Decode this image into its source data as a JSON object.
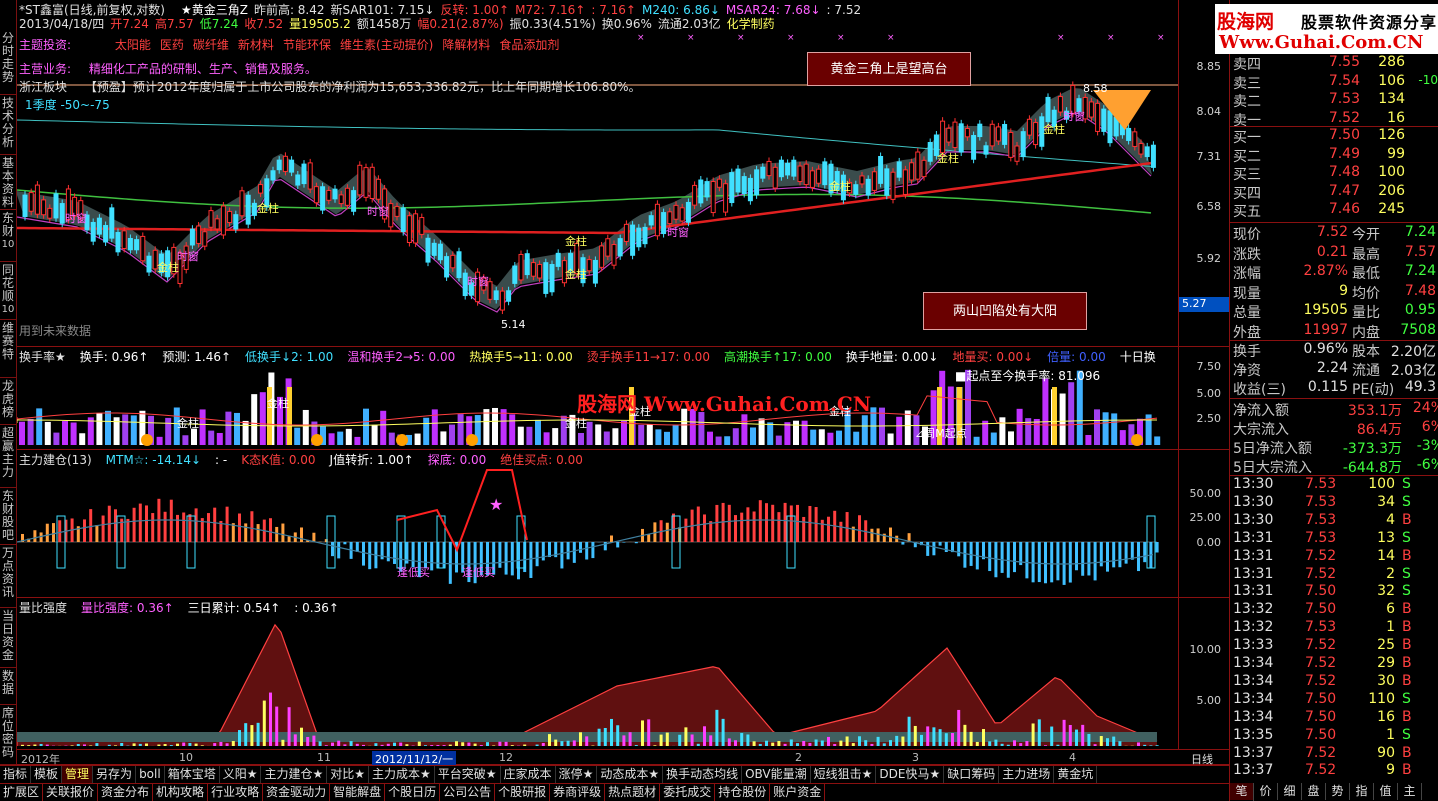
{
  "header": {
    "row1": [
      {
        "text": "*ST鑫富(日线,前复权,对数)",
        "color": "#e0e0e0"
      },
      {
        "text": "★黄金三角Z",
        "color": "#ffffff"
      },
      {
        "text": "昨前高: 8.42",
        "color": "#e0e0e0"
      },
      {
        "text": "新SAR101: 7.15↓",
        "color": "#e0e0e0"
      },
      {
        "text": "反转: 1.00↑",
        "color": "#ff4040"
      },
      {
        "text": "M72: 7.16↑",
        "color": "#ff4040"
      },
      {
        "text": ": 7.16↑",
        "color": "#ff4040"
      },
      {
        "text": "M240: 6.86↓",
        "color": "#40e0ff"
      },
      {
        "text": "MSAR24: 7.68↓",
        "color": "#ff60ff"
      },
      {
        "text": ": 7.52",
        "color": "#e0e0e0"
      }
    ],
    "row2": [
      {
        "text": "2013/04/18/四",
        "color": "#e0e0e0"
      },
      {
        "text": "开7.24",
        "color": "#ff4040"
      },
      {
        "text": "高7.57",
        "color": "#ff4040"
      },
      {
        "text": "低7.24",
        "color": "#40ff40"
      },
      {
        "text": "收7.52",
        "color": "#ff4040"
      },
      {
        "text": "量19505.2",
        "color": "#ffff60"
      },
      {
        "text": "额1458万",
        "color": "#e0e0e0"
      },
      {
        "text": "幅0.21(2.87%)",
        "color": "#ff4040"
      },
      {
        "text": "振0.33(4.51%)",
        "color": "#e0e0e0"
      },
      {
        "text": "换0.96%",
        "color": "#e0e0e0"
      },
      {
        "text": "流通2.03亿",
        "color": "#e0e0e0"
      },
      {
        "text": "化学制药",
        "color": "#ffff60"
      }
    ],
    "theme_label": "主题投资:",
    "themes": [
      "太阳能",
      "医药",
      "碳纤维",
      "新材料",
      "节能环保",
      "维生素(主动提价)",
      "降解材料",
      "食品添加剂"
    ],
    "business_label": "主营业务:",
    "business": "精细化工产品的研制、生产、销售及服务。",
    "region": "浙江板块",
    "news": "【预盈】预计2012年度归属于上市公司股东的净利润为15,653,336.82元，比上年同期增长106.80%。",
    "quarter": "1季度 -50~-75",
    "future_label": "用到未来数据"
  },
  "price_pane": {
    "y_ticks": [
      "8.85",
      "8.04",
      "7.31",
      "6.58",
      "5.92"
    ],
    "current_price_tag": "5.27",
    "low_label": "5.14",
    "high_label": "8.58",
    "note_top": "黄金三角上是望高台",
    "note_bottom": "两山凹陷处有大阳",
    "jinzhu": "金柱",
    "shichuang": "时窗"
  },
  "turnover_pane": {
    "header": [
      {
        "text": "换手率★",
        "color": "#e0e0e0"
      },
      {
        "text": "换手: 0.96↑",
        "color": "#ffffff"
      },
      {
        "text": "预测: 1.46↑",
        "color": "#ffffff"
      },
      {
        "text": "低换手↓2: 1.00",
        "color": "#40e0ff"
      },
      {
        "text": "温和换手2→5: 0.00",
        "color": "#ff60ff"
      },
      {
        "text": "热换手5→11: 0.00",
        "color": "#ffff60"
      },
      {
        "text": "烫手换手11→17: 0.00",
        "color": "#ff4040"
      },
      {
        "text": "高潮换手↑17: 0.00",
        "color": "#40ff40"
      },
      {
        "text": "换手地量: 0.00↓",
        "color": "#ffffff"
      },
      {
        "text": "地量买: 0.00↓",
        "color": "#ff4040"
      },
      {
        "text": "倍量: 0.00",
        "color": "#4060ff"
      },
      {
        "text": "十日换",
        "color": "#ffffff"
      }
    ],
    "y_ticks": [
      "7.50",
      "5.00",
      "2.50"
    ],
    "start_label": "■起点至今换手率: 81.096",
    "week_label": "周M起点"
  },
  "main_force_pane": {
    "header": [
      {
        "text": "主力建仓(13)",
        "color": "#e0e0e0"
      },
      {
        "text": "MTM☆: -14.14↓",
        "color": "#40e0ff"
      },
      {
        "text": ": -",
        "color": "#ffffff"
      },
      {
        "text": "K态K值: 0.00",
        "color": "#ff4040"
      },
      {
        "text": "J值转折: 1.00↑",
        "color": "#ffffff"
      },
      {
        "text": "探底: 0.00",
        "color": "#ff60ff"
      },
      {
        "text": "绝佳买点: 0.00",
        "color": "#ff4040"
      }
    ],
    "y_ticks": [
      "50.00",
      "25.00",
      "0.00"
    ],
    "label_a": "逢低买",
    "label_b": "逢低买"
  },
  "vol_ratio_pane": {
    "header": [
      {
        "text": "量比强度",
        "color": "#e0e0e0"
      },
      {
        "text": "量比强度: 0.36↑",
        "color": "#ff60ff"
      },
      {
        "text": "三日累计: 0.54↑",
        "color": "#ffffff"
      },
      {
        "text": ": 0.36↑",
        "color": "#ffffff"
      }
    ],
    "y_ticks": [
      "10.00",
      "5.00"
    ]
  },
  "date_axis": {
    "labels": [
      "2012年",
      "10",
      "11",
      "2012/11/12/一",
      "12",
      "2",
      "3",
      "4"
    ],
    "period": "日线"
  },
  "watermark": "股海网 Www.Guhai.Com.CN",
  "logo": {
    "line1": "股海网",
    "line1b": "股票软件资源分享",
    "line2": "Www.Guhai.Com.CN"
  },
  "left_tabs": [
    {
      "label": "分时走势",
      "num": ""
    },
    {
      "label": "技术分析",
      "num": ""
    },
    {
      "label": "基本资料",
      "num": ""
    },
    {
      "label": "东财",
      "num": "10"
    },
    {
      "label": "同花顺",
      "num": "10"
    },
    {
      "label": "维赛特",
      "num": ""
    },
    {
      "label": "龙虎榜",
      "num": ""
    },
    {
      "label": "超赢主力",
      "num": ""
    },
    {
      "label": "东财股吧",
      "num": ""
    },
    {
      "label": "万点资讯",
      "num": ""
    },
    {
      "label": "当日资金",
      "num": ""
    },
    {
      "label": "数据",
      "num": ""
    },
    {
      "label": "席位密码",
      "num": ""
    },
    {
      "label": "公",
      "num": ""
    }
  ],
  "order_book": {
    "asks": [
      {
        "label": "卖四",
        "price": "7.55",
        "vol": "286",
        "chg": ""
      },
      {
        "label": "卖三",
        "price": "7.54",
        "vol": "106",
        "chg": "-10"
      },
      {
        "label": "卖二",
        "price": "7.53",
        "vol": "134",
        "chg": ""
      },
      {
        "label": "卖一",
        "price": "7.52",
        "vol": "16",
        "chg": ""
      }
    ],
    "bids": [
      {
        "label": "买一",
        "price": "7.50",
        "vol": "126",
        "chg": ""
      },
      {
        "label": "买二",
        "price": "7.49",
        "vol": "99",
        "chg": ""
      },
      {
        "label": "买三",
        "price": "7.48",
        "vol": "100",
        "chg": ""
      },
      {
        "label": "买四",
        "price": "7.47",
        "vol": "206",
        "chg": ""
      },
      {
        "label": "买五",
        "price": "7.46",
        "vol": "245",
        "chg": ""
      }
    ]
  },
  "quote": [
    {
      "l": "现价",
      "lv": "7.52",
      "lc": "red",
      "r": "今开",
      "rv": "7.24",
      "rc": "green"
    },
    {
      "l": "涨跌",
      "lv": "0.21",
      "lc": "red",
      "r": "最高",
      "rv": "7.57",
      "rc": "red"
    },
    {
      "l": "涨幅",
      "lv": "2.87%",
      "lc": "red",
      "r": "最低",
      "rv": "7.24",
      "rc": "green"
    },
    {
      "l": "现量",
      "lv": "9",
      "lc": "yellow",
      "r": "均价",
      "rv": "7.48",
      "rc": "red"
    },
    {
      "l": "总量",
      "lv": "19505",
      "lc": "yellow",
      "r": "量比",
      "rv": "0.95",
      "rc": "green"
    },
    {
      "l": "外盘",
      "lv": "11997",
      "lc": "red",
      "r": "内盘",
      "rv": "7508",
      "rc": "green"
    }
  ],
  "quote2": [
    {
      "l": "换手",
      "lv": "0.96%",
      "lc": "white",
      "r": "股本",
      "rv": "2.20亿",
      "rc": "white"
    },
    {
      "l": "净资",
      "lv": "2.24",
      "lc": "white",
      "r": "流通",
      "rv": "2.03亿",
      "rc": "white"
    },
    {
      "l": "收益(三)",
      "lv": "0.115",
      "lc": "white",
      "r": "PE(动)",
      "rv": "49.3",
      "rc": "white"
    }
  ],
  "flows": [
    {
      "l": "净流入额",
      "v": "353.1万",
      "p": "24%",
      "c": "red"
    },
    {
      "l": "大宗流入",
      "v": "86.4万",
      "p": "6%",
      "c": "red"
    },
    {
      "l": "5日净流入额",
      "v": "-373.3万",
      "p": "-3%",
      "c": "green"
    },
    {
      "l": "5日大宗流入",
      "v": "-644.8万",
      "p": "-6%",
      "c": "green"
    }
  ],
  "ticks": [
    {
      "t": "13:30",
      "p": "7.53",
      "v": "100",
      "d": "S",
      "dc": "green"
    },
    {
      "t": "13:30",
      "p": "7.53",
      "v": "34",
      "d": "S",
      "dc": "green"
    },
    {
      "t": "13:30",
      "p": "7.53",
      "v": "4",
      "d": "B",
      "dc": "red"
    },
    {
      "t": "13:31",
      "p": "7.53",
      "v": "13",
      "d": "S",
      "dc": "green"
    },
    {
      "t": "13:31",
      "p": "7.52",
      "v": "14",
      "d": "B",
      "dc": "red"
    },
    {
      "t": "13:31",
      "p": "7.52",
      "v": "2",
      "d": "S",
      "dc": "green"
    },
    {
      "t": "13:31",
      "p": "7.50",
      "v": "32",
      "d": "S",
      "dc": "green"
    },
    {
      "t": "13:32",
      "p": "7.50",
      "v": "6",
      "d": "B",
      "dc": "red"
    },
    {
      "t": "13:32",
      "p": "7.53",
      "v": "1",
      "d": "B",
      "dc": "red"
    },
    {
      "t": "13:33",
      "p": "7.52",
      "v": "25",
      "d": "B",
      "dc": "red"
    },
    {
      "t": "13:34",
      "p": "7.52",
      "v": "29",
      "d": "B",
      "dc": "red"
    },
    {
      "t": "13:34",
      "p": "7.52",
      "v": "30",
      "d": "B",
      "dc": "red"
    },
    {
      "t": "13:34",
      "p": "7.50",
      "v": "110",
      "d": "S",
      "dc": "green"
    },
    {
      "t": "13:34",
      "p": "7.50",
      "v": "16",
      "d": "B",
      "dc": "red"
    },
    {
      "t": "13:35",
      "p": "7.50",
      "v": "1",
      "d": "S",
      "dc": "green"
    },
    {
      "t": "13:37",
      "p": "7.52",
      "v": "90",
      "d": "B",
      "dc": "red"
    },
    {
      "t": "13:37",
      "p": "7.52",
      "v": "9",
      "d": "B",
      "dc": "red"
    }
  ],
  "right_tabs": [
    "笔",
    "价",
    "细",
    "盘",
    "势",
    "指",
    "值",
    "主",
    "筹"
  ],
  "bottom_tabs_1": [
    "指标",
    "模板",
    "管理",
    "另存为",
    "boll",
    "箱体宝塔",
    "义阳★",
    "主力建仓★",
    "对比★",
    "主力成本★",
    "平台突破★",
    "庄家成本",
    "涨停★",
    "动态成本★",
    "换手动态均线",
    "OBV能量潮",
    "短线狙击★",
    "DDE快马★",
    "缺口筹码",
    "主力进场",
    "黄金坑"
  ],
  "bottom_tabs_1_active": "管理",
  "bottom_tabs_2": [
    "扩展区",
    "关联报价",
    "资金分布",
    "机构攻略",
    "行业攻略",
    "资金驱动力",
    "智能解盘",
    "个股日历",
    "公司公告",
    "个股研报",
    "券商评级",
    "热点题材",
    "委托成交",
    "持仓股份",
    "账户资金"
  ]
}
